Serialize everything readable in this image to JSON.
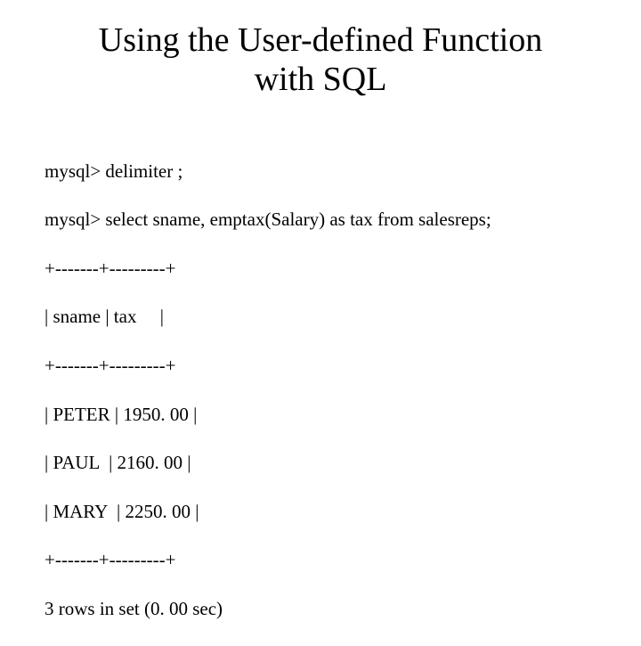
{
  "title": "Using the User-defined Function\nwith SQL",
  "lines": [
    "mysql> delimiter ;",
    "mysql> select sname, emptax(Salary) as tax from salesreps;",
    "+-------+---------+",
    "| sname | tax     |",
    "+-------+---------+",
    "| PETER | 1950. 00 |",
    "| PAUL  | 2160. 00 |",
    "| MARY  | 2250. 00 |",
    "+-------+---------+",
    "3 rows in set (0. 00 sec)"
  ]
}
